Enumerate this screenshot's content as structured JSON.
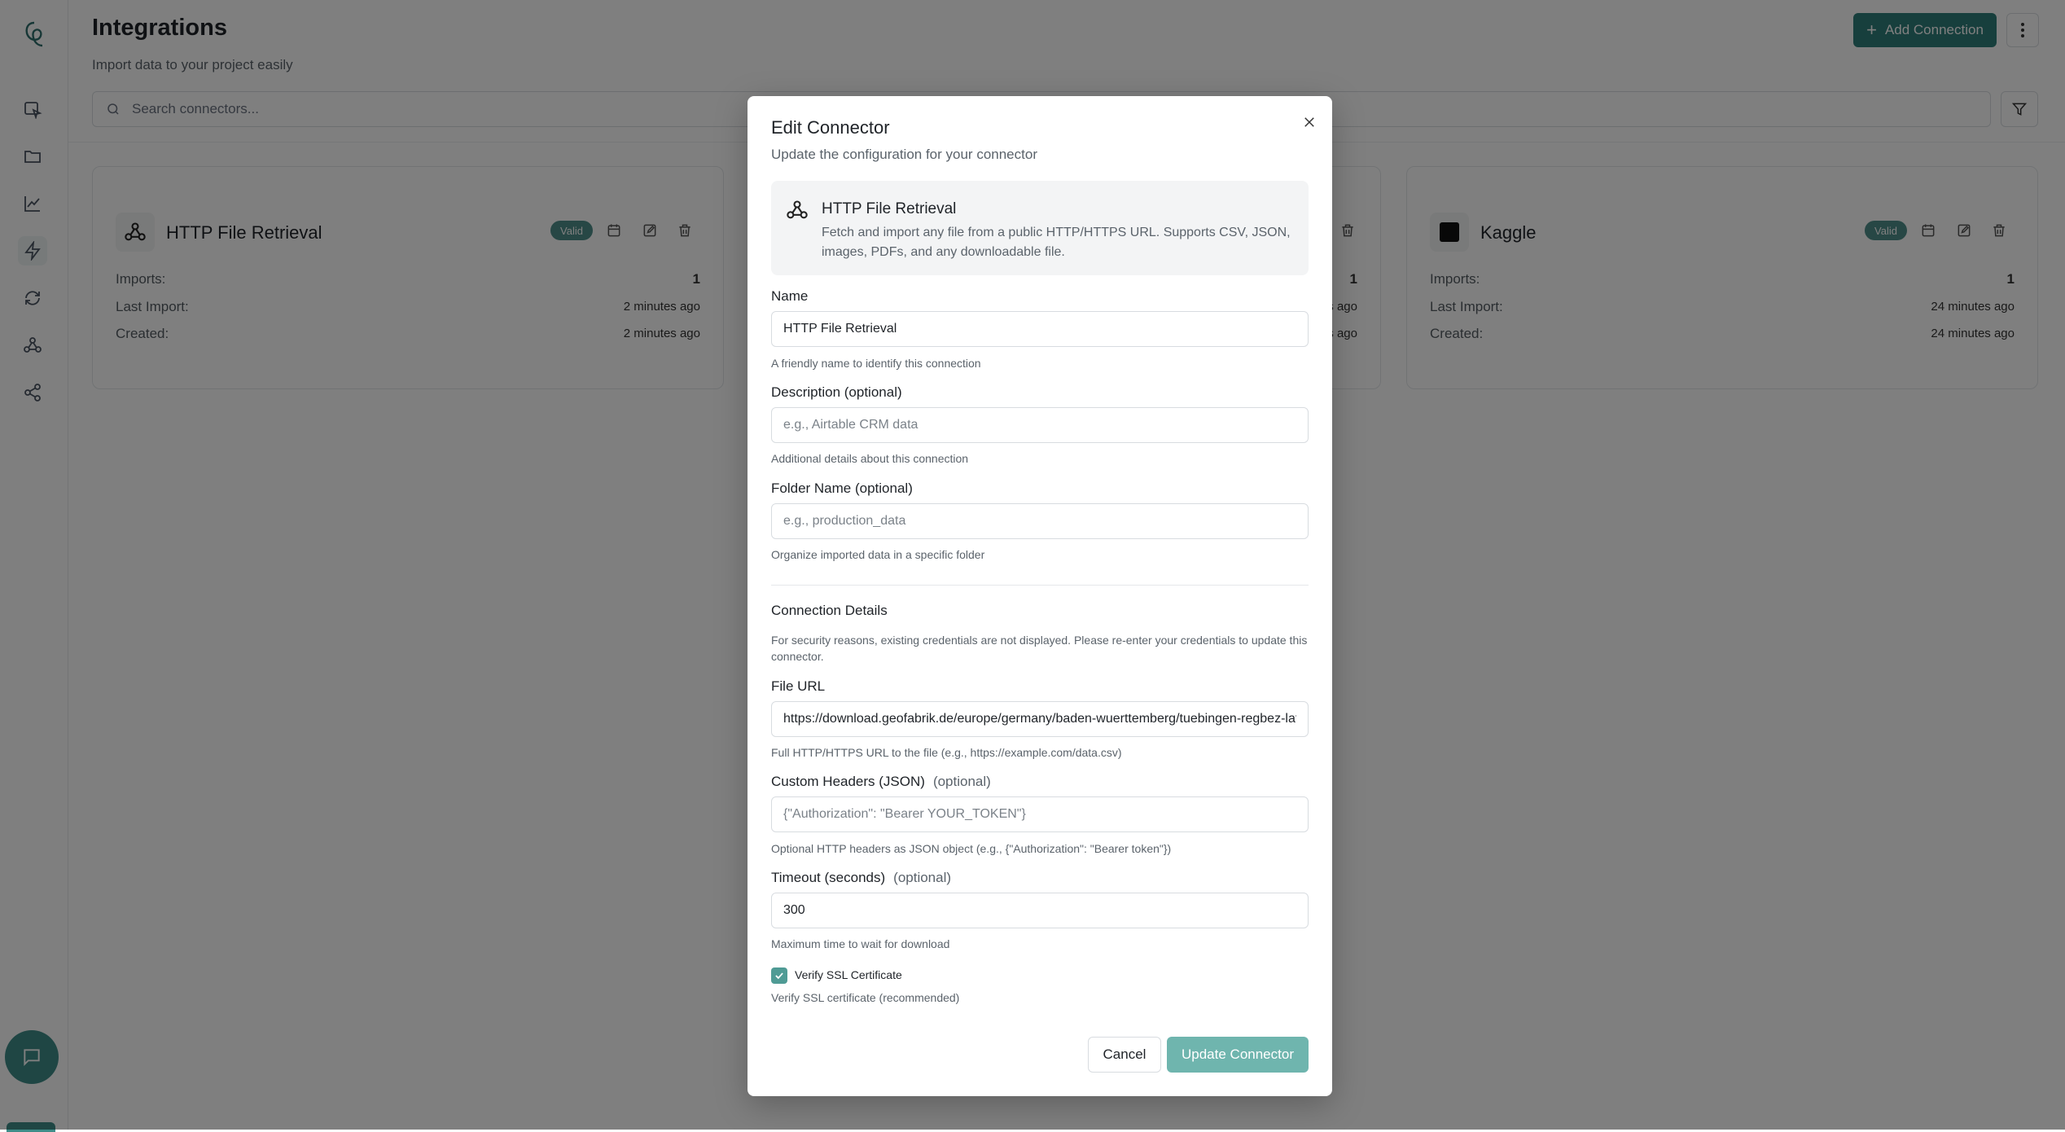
{
  "page": {
    "title": "Integrations",
    "subtitle": "Import data to your project easily",
    "add_button": "Add Connection",
    "search_placeholder": "Search connectors..."
  },
  "sidebar": {
    "items": [
      {
        "icon": "edit-cursor-icon"
      },
      {
        "icon": "folder-icon"
      },
      {
        "icon": "line-chart-icon"
      },
      {
        "icon": "lightning-icon",
        "active": true
      },
      {
        "icon": "refresh-icon"
      },
      {
        "icon": "webhook-icon"
      },
      {
        "icon": "share-icon"
      }
    ],
    "chat_icon": "chat-icon"
  },
  "cards": [
    {
      "title": "HTTP File Retrieval",
      "badge": "Valid",
      "imports_label": "Imports:",
      "imports": "1",
      "last_import_label": "Last Import:",
      "last_import": "2 minutes ago",
      "created_label": "Created:",
      "created": "2 minutes ago"
    },
    {
      "title": "",
      "imports": "1",
      "last_import": "es ago",
      "created": "es ago"
    },
    {
      "title": "Kaggle",
      "badge": "Valid",
      "imports_label": "Imports:",
      "imports": "1",
      "last_import_label": "Last Import:",
      "last_import": "24 minutes ago",
      "created_label": "Created:",
      "created": "24 minutes ago"
    }
  ],
  "modal": {
    "title": "Edit Connector",
    "subtitle": "Update the configuration for your connector",
    "connector": {
      "name": "HTTP File Retrieval",
      "description": "Fetch and import any file from a public HTTP/HTTPS URL. Supports CSV, JSON, images, PDFs, and any downloadable file."
    },
    "fields": {
      "name": {
        "label": "Name",
        "value": "HTTP File Retrieval",
        "help": "A friendly name to identify this connection"
      },
      "description": {
        "label": "Description (optional)",
        "placeholder": "e.g., Airtable CRM data",
        "help": "Additional details about this connection"
      },
      "folder": {
        "label": "Folder Name (optional)",
        "placeholder": "e.g., production_data",
        "help": "Organize imported data in a specific folder"
      }
    },
    "connection_details": {
      "title": "Connection Details",
      "note": "For security reasons, existing credentials are not displayed. Please re-enter your credentials to update this connector."
    },
    "file_url": {
      "label": "File URL",
      "value": "https://download.geofabrik.de/europe/germany/baden-wuerttemberg/tuebingen-regbez-latest.osm.pbf",
      "help": "Full HTTP/HTTPS URL to the file (e.g., https://example.com/data.csv)"
    },
    "headers": {
      "label": "Custom Headers (JSON)",
      "optional": "(optional)",
      "placeholder": "{\"Authorization\": \"Bearer YOUR_TOKEN\"}",
      "help": "Optional HTTP headers as JSON object (e.g., {\"Authorization\": \"Bearer token\"})"
    },
    "timeout": {
      "label": "Timeout (seconds)",
      "optional": "(optional)",
      "value": "300",
      "help": "Maximum time to wait for download"
    },
    "ssl": {
      "label": "Verify SSL Certificate",
      "checked": true,
      "help": "Verify SSL certificate (recommended)"
    },
    "cancel_label": "Cancel",
    "update_label": "Update Connector"
  },
  "colors": {
    "accent": "#2f7f7a",
    "badge": "#4f8f8a",
    "update_button": "#6fb5ae",
    "overlay": "rgba(0,0,0,0.5)"
  }
}
